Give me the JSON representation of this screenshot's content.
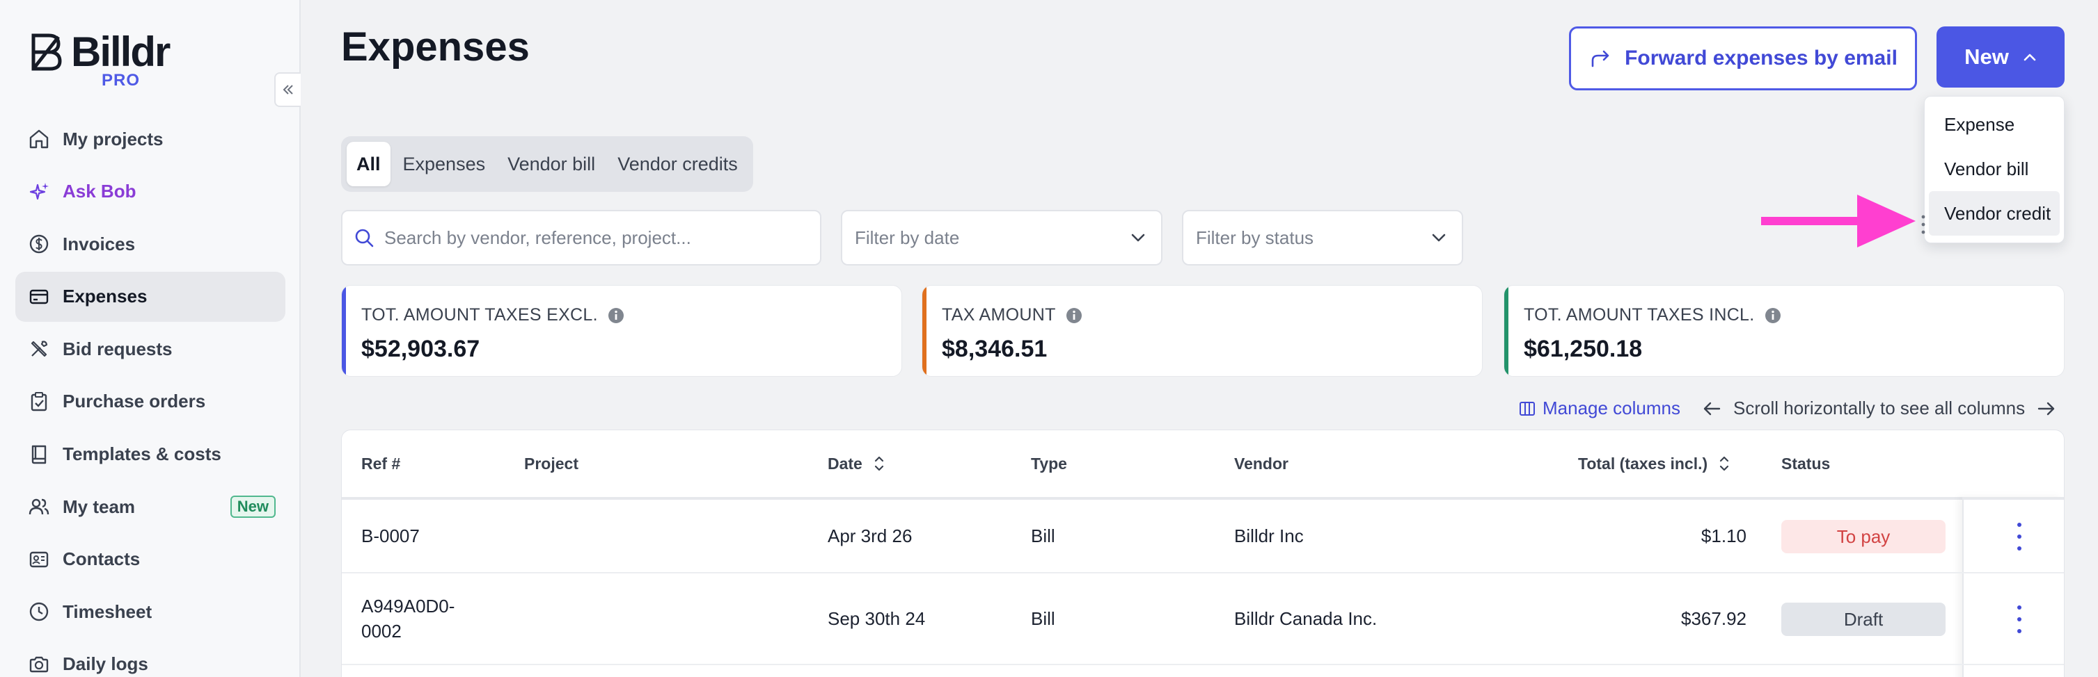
{
  "app": {
    "name": "Billdr",
    "tier": "PRO"
  },
  "sidebar": {
    "items": [
      {
        "label": "My projects",
        "icon": "home-icon"
      },
      {
        "label": "Ask Bob",
        "icon": "sparkle-icon"
      },
      {
        "label": "Invoices",
        "icon": "dollar-circle-icon"
      },
      {
        "label": "Expenses",
        "icon": "credit-card-icon",
        "active": true
      },
      {
        "label": "Bid requests",
        "icon": "tools-icon"
      },
      {
        "label": "Purchase orders",
        "icon": "clipboard-check-icon"
      },
      {
        "label": "Templates & costs",
        "icon": "book-icon"
      },
      {
        "label": "My team",
        "icon": "users-icon",
        "badge": "New"
      },
      {
        "label": "Contacts",
        "icon": "contact-card-icon"
      },
      {
        "label": "Timesheet",
        "icon": "clock-icon"
      },
      {
        "label": "Daily logs",
        "icon": "camera-icon"
      }
    ]
  },
  "header": {
    "title": "Expenses",
    "forward_label": "Forward expenses by email",
    "new_label": "New"
  },
  "new_menu": {
    "items": [
      "Expense",
      "Vendor bill",
      "Vendor credit"
    ],
    "highlighted": "Vendor credit"
  },
  "tabs": [
    "All",
    "Expenses",
    "Vendor bill",
    "Vendor credits"
  ],
  "filters": {
    "search_placeholder": "Search by vendor, reference, project...",
    "date_placeholder": "Filter by date",
    "status_placeholder": "Filter by status"
  },
  "kpis": [
    {
      "label": "TOT. AMOUNT TAXES EXCL.",
      "value": "$52,903.67",
      "color": "#4b57e4"
    },
    {
      "label": "TAX AMOUNT",
      "value": "$8,346.51",
      "color": "#e0701e"
    },
    {
      "label": "TOT. AMOUNT TAXES INCL.",
      "value": "$61,250.18",
      "color": "#23936a"
    }
  ],
  "toolbar": {
    "manage_columns": "Manage columns",
    "scroll_hint": "Scroll horizontally to see all columns"
  },
  "table": {
    "columns": [
      "Ref #",
      "Project",
      "Date",
      "Type",
      "Vendor",
      "Total (taxes incl.)",
      "Status"
    ],
    "rows": [
      {
        "ref": "B-0007",
        "project": "",
        "date": "Apr 3rd 26",
        "type": "Bill",
        "vendor": "Billdr Inc",
        "total": "$1.10",
        "status": "To pay"
      },
      {
        "ref_line1": "A949A0D0-",
        "ref_line2": "0002",
        "project": "",
        "date": "Sep 30th 24",
        "type": "Bill",
        "vendor": "Billdr Canada Inc.",
        "total": "$367.92",
        "status": "Draft"
      }
    ]
  },
  "colors": {
    "accent": "#4b57e4",
    "annotation_arrow": "#ff3fd0"
  }
}
